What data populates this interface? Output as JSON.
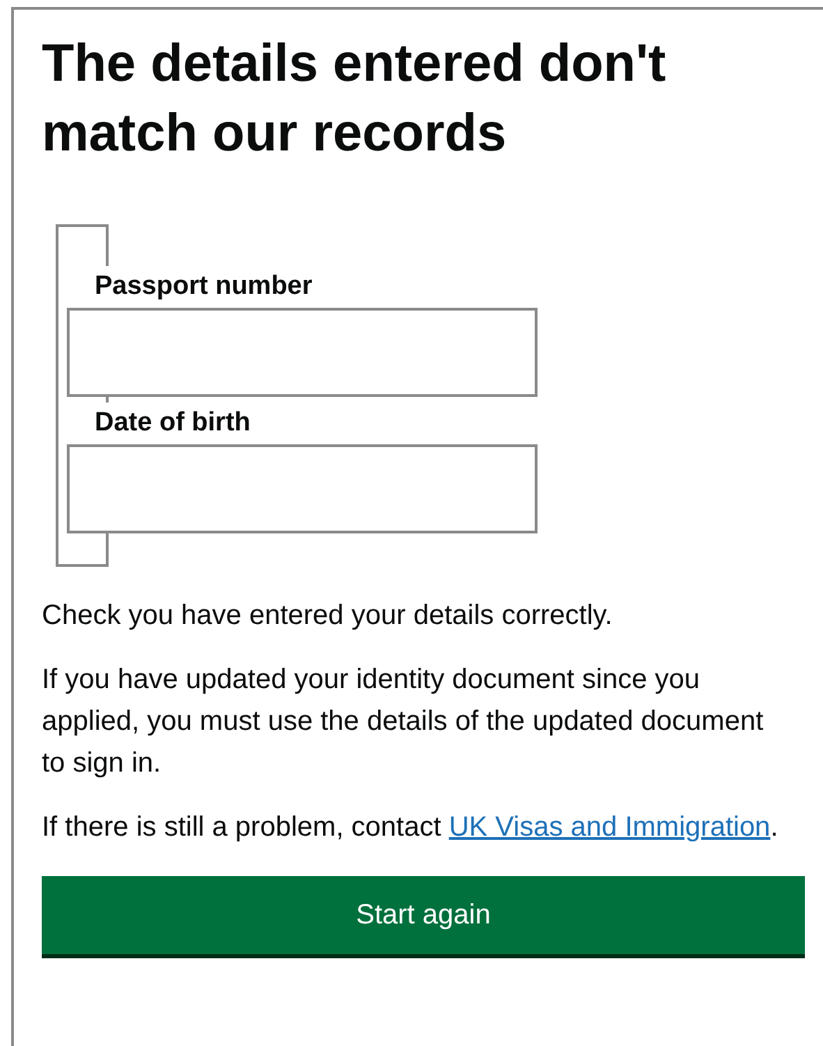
{
  "heading": "The details entered don't match our records",
  "fields": [
    {
      "label": "Passport number"
    },
    {
      "label": "Date of birth"
    }
  ],
  "paragraphs": [
    "Check you have entered your details correctly.",
    "If you have updated your identity document since you applied, you must use the details of the updated document to sign in."
  ],
  "contact": {
    "text": "If there is still a problem, contact ",
    "link": "UK Visas and Immigration",
    "after": "."
  },
  "button": "Start again"
}
